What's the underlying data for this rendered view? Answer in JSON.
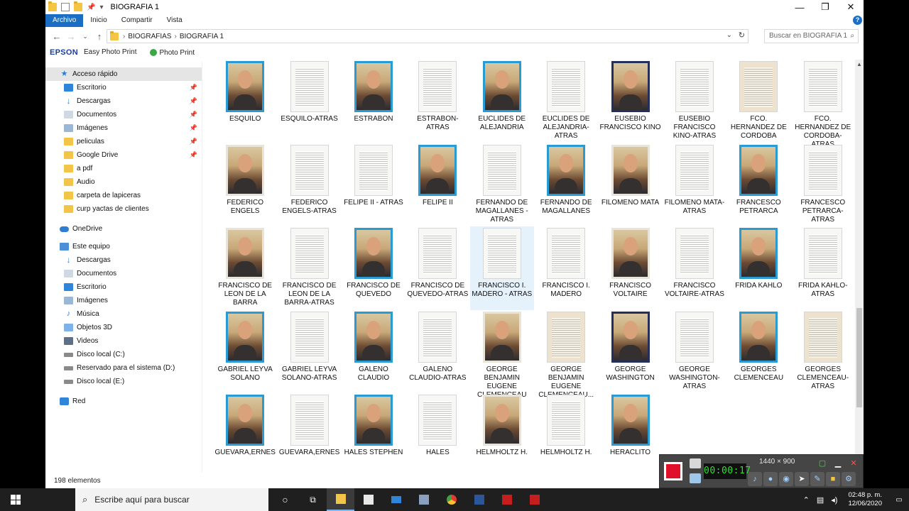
{
  "window": {
    "title": "BIOGRAFIA 1",
    "minimize": "—",
    "maximize": "❐",
    "close": "✕"
  },
  "ribbon": {
    "tabs": [
      "Archivo",
      "Inicio",
      "Compartir",
      "Vista"
    ],
    "help": "?"
  },
  "address": {
    "crumbs": [
      "BIOGRAFIAS",
      "BIOGRAFIA 1"
    ],
    "search_placeholder": "Buscar en BIOGRAFIA 1"
  },
  "epson": {
    "brand": "EPSON",
    "easy": "Easy Photo Print",
    "photo": "Photo Print"
  },
  "nav": {
    "quick_access": "Acceso rápido",
    "quick_items": [
      "Escritorio",
      "Descargas",
      "Documentos",
      "Imágenes",
      "peliculas",
      "Google Drive",
      "a pdf",
      "Audio",
      "carpeta de lapiceras",
      "curp yactas de clientes"
    ],
    "onedrive": "OneDrive",
    "this_pc": "Este equipo",
    "pc_items": [
      "Descargas",
      "Documentos",
      "Escritorio",
      "Imágenes",
      "Música",
      "Objetos 3D",
      "Videos",
      "Disco local (C:)",
      "Reservado para el sistema (D:)",
      "Disco local (E:)"
    ],
    "network": "Red"
  },
  "files": [
    "ESQUILO",
    "ESQUILO-ATRAS",
    "ESTRABON",
    "ESTRABON-ATRAS",
    "EUCLIDES DE ALEJANDRIA",
    "EUCLIDES DE ALEJANDRIA-ATRAS",
    "EUSEBIO FRANCISCO KINO",
    "EUSEBIO FRANCISCO KINO-ATRAS",
    "FCO. HERNANDEZ DE CORDOBA",
    "FCO. HERNANDEZ DE CORDOBA-ATRAS",
    "FEDERICO ENGELS",
    "FEDERICO ENGELS-ATRAS",
    "FELIPE II - ATRAS",
    "FELIPE II",
    "FERNANDO DE MAGALLANES - ATRAS",
    "FERNANDO DE MAGALLANES",
    "FILOMENO MATA",
    "FILOMENO MATA-ATRAS",
    "FRANCESCO PETRARCA",
    "FRANCESCO PETRARCA-ATRAS",
    "FRANCISCO DE LEON DE LA BARRA",
    "FRANCISCO DE LEON DE LA BARRA-ATRAS",
    "FRANCISCO DE QUEVEDO",
    "FRANCISCO DE QUEVEDO-ATRAS",
    "FRANCISCO I. MADERO - ATRAS",
    "FRANCISCO I. MADERO",
    "FRANCISCO VOLTAIRE",
    "FRANCISCO VOLTAIRE-ATRAS",
    "FRIDA KAHLO",
    "FRIDA KAHLO-ATRAS",
    "GABRIEL LEYVA SOLANO",
    "GABRIEL LEYVA SOLANO-ATRAS",
    "GALENO CLAUDIO",
    "GALENO CLAUDIO-ATRAS",
    "GEORGE BENJAMIN EUGENE CLEMENCEAU",
    "GEORGE BENJAMIN EUGENE CLEMENCEAU...",
    "GEORGE WASHINGTON",
    "GEORGE WASHINGTON-ATRAS",
    "GEORGES CLEMENCEAU",
    "GEORGES CLEMENCEAU-ATRAS",
    "GUEVARA,ERNES",
    "GUEVARA,ERNES",
    "HALES STEPHEN",
    "HALES",
    "HELMHOLTZ H.",
    "HELMHOLTZ H.",
    "HERACLITO",
    "",
    "",
    ""
  ],
  "status": {
    "count": "198 elementos"
  },
  "recorder": {
    "timer": "00:00:17",
    "resolution": "1440 × 900"
  },
  "taskbar": {
    "search_placeholder": "Escribe aquí para buscar",
    "time": "02:48 p. m.",
    "date": "12/06/2020"
  }
}
